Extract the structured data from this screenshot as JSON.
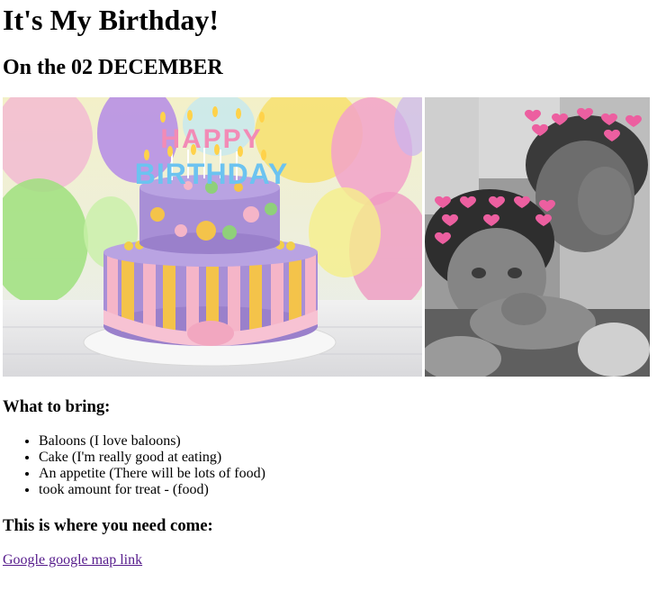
{
  "header": {
    "title": "It's My Birthday!",
    "subtitle": "On the 02 DECEMBER"
  },
  "photos": {
    "cake_candles_text": [
      "HAPPY",
      "BIRTHDAY"
    ],
    "cake_colors": [
      "#a88fd6",
      "#f4c34a",
      "#f5b5c8",
      "#8fd07a"
    ],
    "people_icon": "heart-icon"
  },
  "bring": {
    "heading": "What to bring:",
    "items": [
      "Baloons (I love baloons)",
      "Cake (I'm really good at eating)",
      "An appetite (There will be lots of food)",
      "took amount for treat - (food)"
    ]
  },
  "location": {
    "heading": "This is where you need come:",
    "link_text": "Google google map link",
    "link_color": "#551a8b"
  }
}
